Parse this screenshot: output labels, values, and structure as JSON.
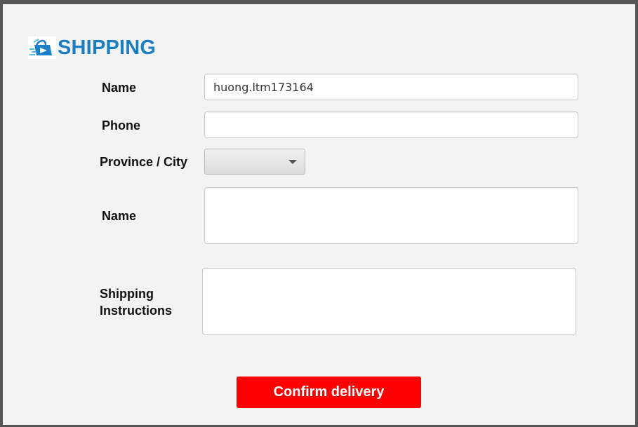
{
  "header": {
    "title": "SHIPPING",
    "logo_icon": "shopping-bag-logo-icon",
    "title_color": "#1b7ec3"
  },
  "form": {
    "name_label": "Name",
    "name_value": "huong.ltm173164",
    "phone_label": "Phone",
    "phone_value": "",
    "province_label": "Province / City",
    "province_value": "",
    "address_label": "Name",
    "address_value": "",
    "instructions_label": "Shipping Instructions",
    "instructions_value": ""
  },
  "actions": {
    "confirm_label": "Confirm delivery",
    "confirm_color": "#ff0000"
  }
}
